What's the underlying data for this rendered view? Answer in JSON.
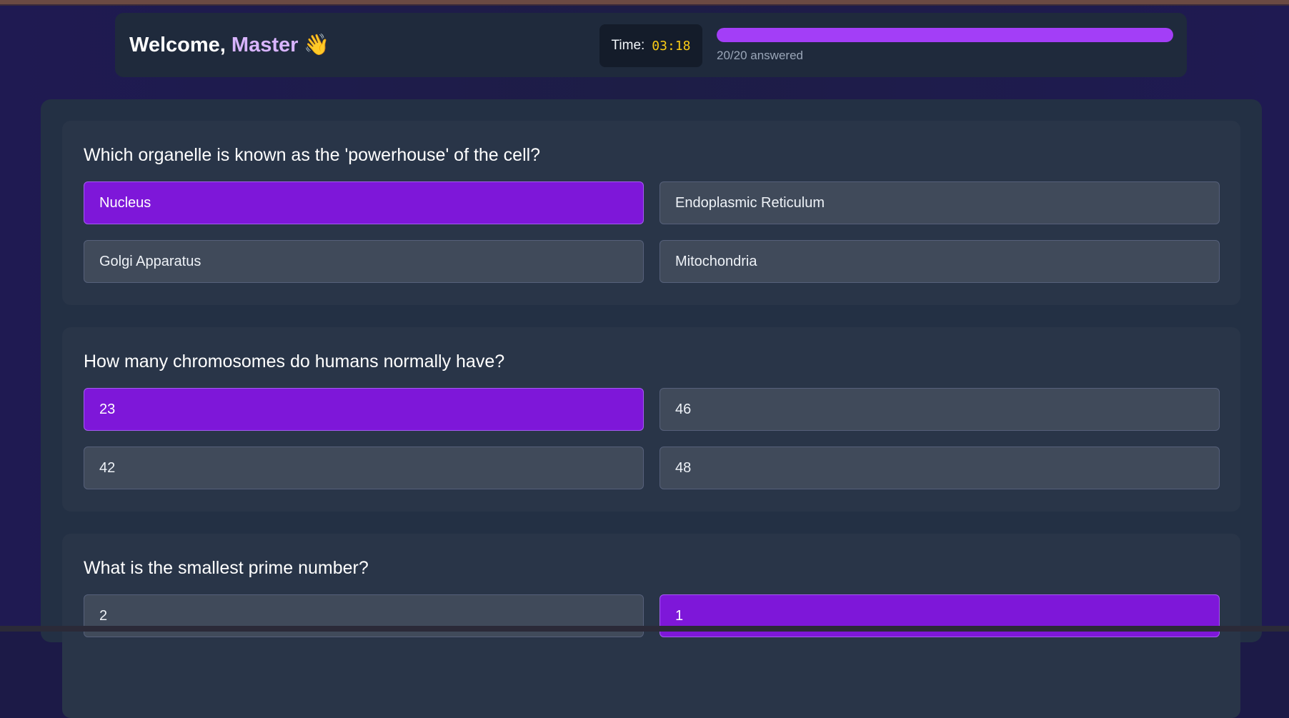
{
  "header": {
    "welcome_prefix": "Welcome, ",
    "user_name": "Master",
    "wave_emoji": "👋",
    "timer_label": "Time:",
    "timer_value": "03:18",
    "progress_fraction": 1.0,
    "progress_text": "20/20 answered"
  },
  "questions": [
    {
      "text": "Which organelle is known as the 'powerhouse' of the cell?",
      "options": [
        "Nucleus",
        "Endoplasmic Reticulum",
        "Golgi Apparatus",
        "Mitochondria"
      ],
      "selected": 0
    },
    {
      "text": "How many chromosomes do humans normally have?",
      "options": [
        "23",
        "46",
        "42",
        "48"
      ],
      "selected": 0
    },
    {
      "text": "What is the smallest prime number?",
      "options": [
        "2",
        "1",
        "",
        ""
      ],
      "selected": 1
    }
  ],
  "colors": {
    "accent": "#7e17d9",
    "progress": "#a33ef7",
    "timer": "#facc15",
    "name_highlight": "#d8b4fe"
  }
}
